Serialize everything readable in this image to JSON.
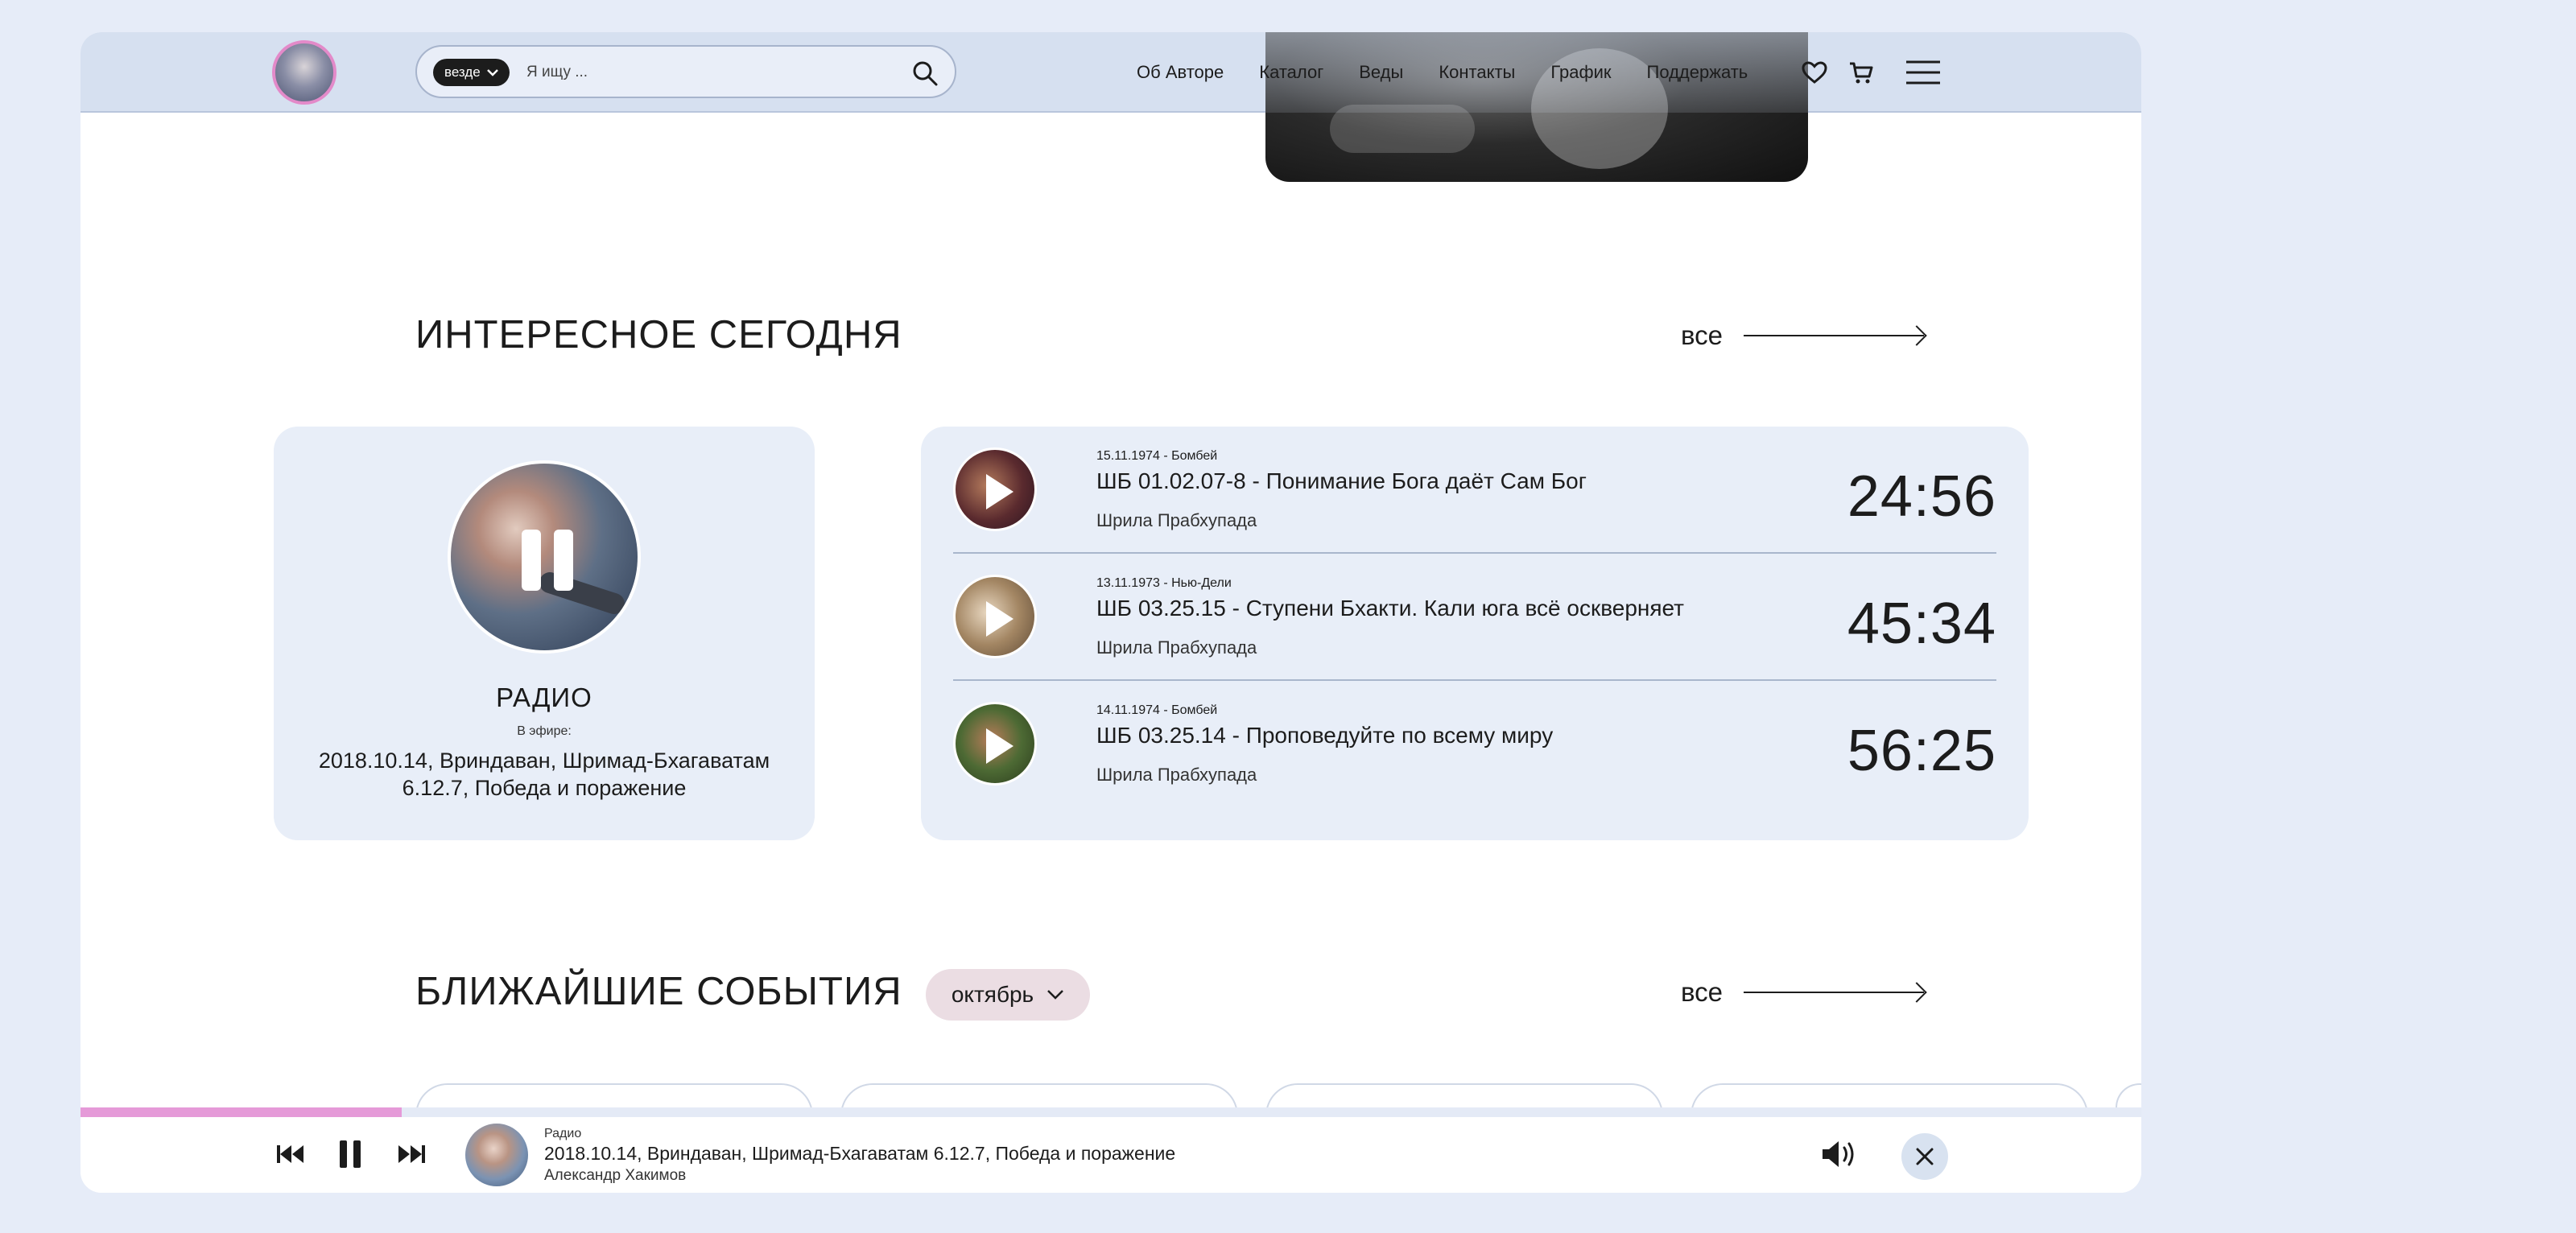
{
  "header": {
    "search": {
      "scope": "везде",
      "placeholder": "Я ищу ..."
    },
    "nav": [
      "Об Авторе",
      "Каталог",
      "Веды",
      "Контакты",
      "График",
      "Поддержать"
    ],
    "icons": [
      "heart-icon",
      "cart-icon",
      "menu-icon"
    ]
  },
  "interesting": {
    "title": "ИНТЕРЕСНОЕ СЕГОДНЯ",
    "all_label": "все",
    "radio": {
      "title": "РАДИО",
      "on_air_label": "В эфире:",
      "now_playing": "2018.10.14, Вриндаван, Шримад-Бхагаватам 6.12.7, Победа и поражение"
    },
    "tracks": [
      {
        "meta": "15.11.1974 - Бомбей",
        "title": "ШБ 01.02.07-8 - Понимание Бога даёт Сам Бог",
        "author": "Шрила Прабхупада",
        "duration": "24:56",
        "thumb_color": "#5a2a2e"
      },
      {
        "meta": "13.11.1973 - Нью-Дели",
        "title": "ШБ 03.25.15 - Ступени Бхакти. Кали юга всё оскверняет",
        "author": "Шрила Прабхупада",
        "duration": "45:34",
        "thumb_color": "#8b6e52"
      },
      {
        "meta": "14.11.1974 - Бомбей",
        "title": "ШБ 03.25.14 - Проповедуйте по всему миру",
        "author": "Шрила Прабхупада",
        "duration": "56:25",
        "thumb_color": "#3d5a2a"
      }
    ]
  },
  "events": {
    "title": "БЛИЖАЙШИЕ СОБЫТИЯ",
    "month": "октябрь",
    "all_label": "все"
  },
  "player": {
    "progress": 0.156,
    "kind": "Радио",
    "title": "2018.10.14, Вриндаван, Шримад-Бхагаватам 6.12.7, Победа и поражение",
    "author": "Александр Хакимов"
  },
  "colors": {
    "header_bg": "#d6e0f0",
    "card_bg": "#e8eef8",
    "progress": "#e59ad8",
    "page_bg": "#e6ecf8"
  }
}
